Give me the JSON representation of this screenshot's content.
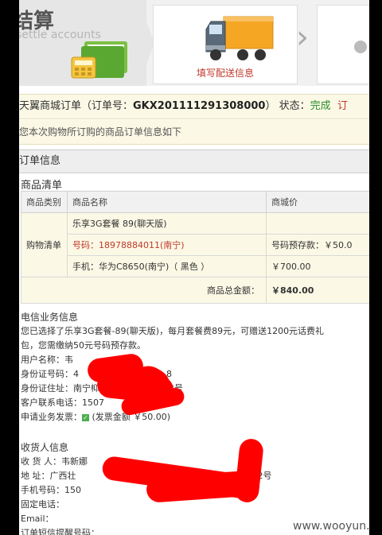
{
  "header": {
    "title": "结算",
    "subtitle": "settle accounts",
    "step_label": "填写配送信息",
    "truck_colors": {
      "cargo": "#f5a623",
      "cab": "#5a6a78"
    }
  },
  "order_bar": {
    "prefix": "天翼商城订单（订单号：",
    "order_no": "GKX201111291308000",
    "suffix": "） 状态：",
    "status": "完成",
    "view": "订"
  },
  "info_bar": {
    "text": "您本次购物所订购的商品订单信息如下"
  },
  "order_section": {
    "title": "订单信息",
    "product_list_title": "商品清单"
  },
  "table": {
    "headers": [
      "商品类别",
      "商品名称",
      "商城价"
    ],
    "category": "购物清单",
    "rows": [
      {
        "name": "乐享3G套餐 89(聊天版)",
        "price": ""
      },
      {
        "name": "号码：18978884011(南宁)",
        "price": "号码预存款：￥50.0"
      },
      {
        "name": "手机：华为C8650(南宁)（ 黑色 ）",
        "price": "￥700.00"
      }
    ],
    "total_label": "商品总金额：",
    "total_value": "￥840.00"
  },
  "telecom": {
    "title": "电信业务信息",
    "desc1": "您已选择了乐享3G套餐-89(聊天版)，每月套餐费89元，可赠送1200元话费礼",
    "desc2": "包，您需缴纳50元号码预存款。",
    "user_label": "用户名称：韦",
    "id_label": "身份证号码：4",
    "id_tail": "8",
    "addr_label": "身份证住址：南宁枊冫",
    "addr_tail": "0栋2号",
    "phone_label": "客户联系电话：1507",
    "phone_tail": "31",
    "invoice_label": "申请业务发票：",
    "invoice_text": "(发票金额 ￥50.00)"
  },
  "receiver": {
    "title": "收货人信息",
    "name_label": "收 货 人：韦新娜",
    "addr_label": "地    址：广西壮",
    "addr_tail": "0栋2号",
    "mobile_label": "手机号码：150",
    "phone_label": "固定电话：",
    "email_label": "Email：",
    "sms_label": "订单短信提醒号码："
  },
  "watermark": "www.wooyun.org"
}
